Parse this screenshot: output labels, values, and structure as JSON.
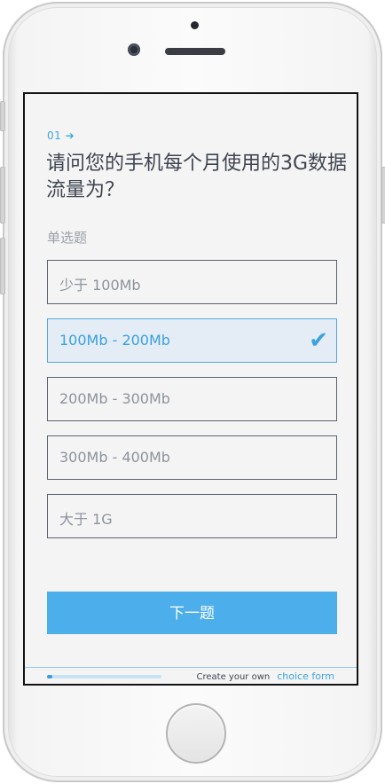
{
  "question": {
    "number": "01 ➔",
    "title": "请问您的手机每个月使用的3G数据流量为？",
    "type_label": "单选题"
  },
  "options": [
    {
      "label": "少于 100Mb",
      "selected": false
    },
    {
      "label": "100Mb - 200Mb",
      "selected": true
    },
    {
      "label": "200Mb - 300Mb",
      "selected": false
    },
    {
      "label": "300Mb - 400Mb",
      "selected": false
    },
    {
      "label": "大于 1G",
      "selected": false
    }
  ],
  "check_mark": "✔",
  "next_button": "下一题",
  "footer": {
    "progress": 0.05,
    "text": "Create your own",
    "accent": "choice form"
  },
  "colors": {
    "accent": "#3da6e6",
    "button": "#4caeea",
    "selected_bg": "#e4edf6",
    "screen_bg": "#f4f4f4"
  }
}
